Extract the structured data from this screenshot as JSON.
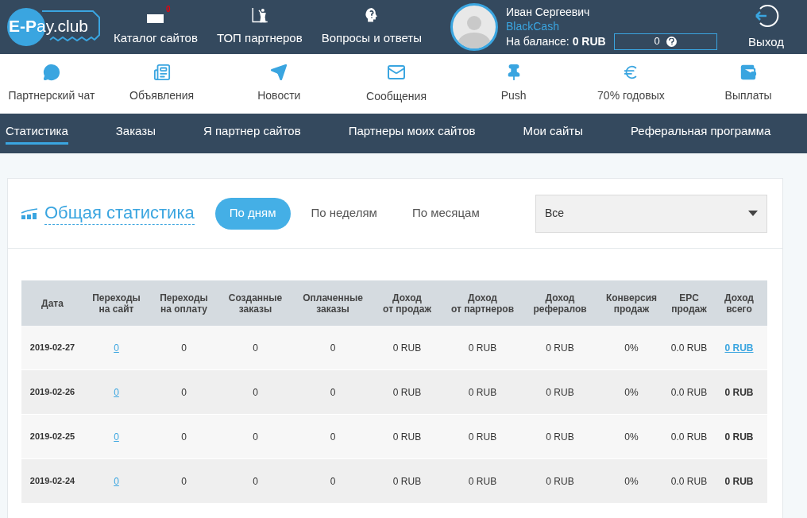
{
  "header": {
    "logo": "**E-P**ay.club",
    "nav": [
      {
        "label": "Каталог сайтов",
        "badge": "0",
        "kind": "catalog"
      },
      {
        "label": "ТОП партнеров",
        "kind": "top"
      },
      {
        "label": "Вопросы и ответы",
        "kind": "faq"
      }
    ],
    "user": {
      "name": "Иван Сергеевич",
      "login": "BlackCash",
      "balance_label": "На балансе:",
      "balance": "0 RUB",
      "points": "0"
    },
    "logout": "Выход"
  },
  "tools": [
    {
      "label": "Партнерский чат",
      "kind": "chat"
    },
    {
      "label": "Объявления",
      "kind": "ads"
    },
    {
      "label": "Новости",
      "kind": "news"
    },
    {
      "label": "Сообщения",
      "kind": "mail"
    },
    {
      "label": "Push",
      "kind": "push"
    },
    {
      "label": "70% годовых",
      "kind": "euro"
    },
    {
      "label": "Выплаты",
      "kind": "wallet"
    }
  ],
  "tabs": [
    {
      "label": "Статистика",
      "selected": true
    },
    {
      "label": "Заказы",
      "selected": false
    },
    {
      "label": "Я партнер сайтов",
      "selected": false
    },
    {
      "label": "Партнеры моих сайтов",
      "selected": false
    },
    {
      "label": "Мои сайты",
      "selected": false
    },
    {
      "label": "Реферальная программа",
      "selected": false
    }
  ],
  "card": {
    "title": "Общая статистика",
    "periods": [
      {
        "label": "По дням",
        "selected": true
      },
      {
        "label": "По неделям",
        "selected": false
      },
      {
        "label": "По месяцам",
        "selected": false
      }
    ],
    "filter": "Все"
  },
  "table": {
    "columns": [
      "Дата",
      "Переходы\nна сайт",
      "Переходы\nна оплату",
      "Созданные\nзаказы",
      "Оплаченные\nзаказы",
      "Доход\nот продаж",
      "Доход\nот партнеров",
      "Доход\nрефералов",
      "Конверсия\nпродаж",
      "EPC\nпродаж",
      "Доход\nвсего"
    ],
    "rows": [
      {
        "cells": [
          "2019-02-27",
          "0",
          "0",
          "0",
          "0",
          "0 RUB",
          "0 RUB",
          "0 RUB",
          "0%",
          "0.0 RUB",
          "0 RUB"
        ],
        "total_link": true
      },
      {
        "cells": [
          "2019-02-26",
          "0",
          "0",
          "0",
          "0",
          "0 RUB",
          "0 RUB",
          "0 RUB",
          "0%",
          "0.0 RUB",
          "0 RUB"
        ],
        "total_link": false
      },
      {
        "cells": [
          "2019-02-25",
          "0",
          "0",
          "0",
          "0",
          "0 RUB",
          "0 RUB",
          "0 RUB",
          "0%",
          "0.0 RUB",
          "0 RUB"
        ],
        "total_link": false
      },
      {
        "cells": [
          "2019-02-24",
          "0",
          "0",
          "0",
          "0",
          "0 RUB",
          "0 RUB",
          "0 RUB",
          "0%",
          "0.0 RUB",
          "0 RUB"
        ],
        "total_link": false
      }
    ]
  }
}
